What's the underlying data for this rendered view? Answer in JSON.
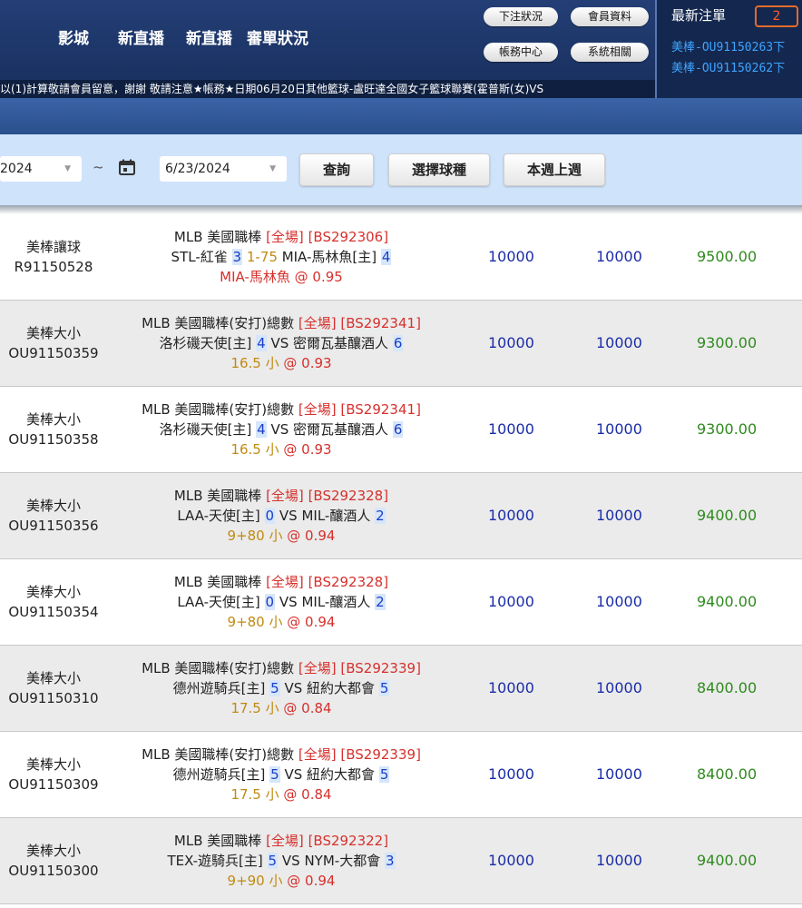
{
  "header": {
    "nav": [
      "影城",
      "新直播",
      "新直播",
      "審單狀況"
    ],
    "buttons": {
      "bet_status": "下注狀況",
      "member_info": "會員資料",
      "accounts": "帳務中心",
      "system": "系統相關"
    },
    "latest": {
      "title": "最新注單",
      "count": "2",
      "lines": [
        "美棒-OU91150263下",
        "美棒-OU91150262下"
      ]
    }
  },
  "ticker": "以(1)計算敬請會員留意，謝謝 敬請注意★帳務★日期06月20日其他籃球-盧旺達全國女子籃球聯賽(霍普斯(女)VS",
  "filter": {
    "start_date": "2024",
    "separator": "~",
    "end_date": "6/23/2024",
    "query": "查詢",
    "select_sport": "選擇球種",
    "week": "本週上週"
  },
  "rows": [
    {
      "type": "美棒讓球",
      "id": "R91150528",
      "league": "MLB 美國職棒",
      "market": "[全場]",
      "code": "[BS292306]",
      "home": "STL-紅雀",
      "home_score": "3",
      "handicap": "1-75",
      "away": "MIA-馬林魚[主]",
      "away_score": "4",
      "pick": "MIA-馬林魚",
      "pick_style": "red",
      "odds": "@ 0.95",
      "bet": "10000",
      "valid": "10000",
      "win": "9500.00"
    },
    {
      "type": "美棒大小",
      "id": "OU91150359",
      "league": "MLB 美國職棒(安打)總數",
      "market": "[全場]",
      "code": "[BS292341]",
      "home": "洛杉磯天使[主]",
      "home_score": "4",
      "handicap": "VS",
      "away": "密爾瓦基釀酒人",
      "away_score": "6",
      "pick": "16.5 小",
      "pick_style": "gold",
      "odds": "@ 0.93",
      "bet": "10000",
      "valid": "10000",
      "win": "9300.00"
    },
    {
      "type": "美棒大小",
      "id": "OU91150358",
      "league": "MLB 美國職棒(安打)總數",
      "market": "[全場]",
      "code": "[BS292341]",
      "home": "洛杉磯天使[主]",
      "home_score": "4",
      "handicap": "VS",
      "away": "密爾瓦基釀酒人",
      "away_score": "6",
      "pick": "16.5 小",
      "pick_style": "gold",
      "odds": "@ 0.93",
      "bet": "10000",
      "valid": "10000",
      "win": "9300.00"
    },
    {
      "type": "美棒大小",
      "id": "OU91150356",
      "league": "MLB 美國職棒",
      "market": "[全場]",
      "code": "[BS292328]",
      "home": "LAA-天使[主]",
      "home_score": "0",
      "handicap": "VS",
      "away": "MIL-釀酒人",
      "away_score": "2",
      "pick": "9+80 小",
      "pick_style": "gold",
      "odds": "@ 0.94",
      "bet": "10000",
      "valid": "10000",
      "win": "9400.00"
    },
    {
      "type": "美棒大小",
      "id": "OU91150354",
      "league": "MLB 美國職棒",
      "market": "[全場]",
      "code": "[BS292328]",
      "home": "LAA-天使[主]",
      "home_score": "0",
      "handicap": "VS",
      "away": "MIL-釀酒人",
      "away_score": "2",
      "pick": "9+80 小",
      "pick_style": "gold",
      "odds": "@ 0.94",
      "bet": "10000",
      "valid": "10000",
      "win": "9400.00"
    },
    {
      "type": "美棒大小",
      "id": "OU91150310",
      "league": "MLB 美國職棒(安打)總數",
      "market": "[全場]",
      "code": "[BS292339]",
      "home": "德州遊騎兵[主]",
      "home_score": "5",
      "handicap": "VS",
      "away": "紐約大都會",
      "away_score": "5",
      "pick": "17.5 小",
      "pick_style": "gold",
      "odds": "@ 0.84",
      "bet": "10000",
      "valid": "10000",
      "win": "8400.00"
    },
    {
      "type": "美棒大小",
      "id": "OU91150309",
      "league": "MLB 美國職棒(安打)總數",
      "market": "[全場]",
      "code": "[BS292339]",
      "home": "德州遊騎兵[主]",
      "home_score": "5",
      "handicap": "VS",
      "away": "紐約大都會",
      "away_score": "5",
      "pick": "17.5 小",
      "pick_style": "gold",
      "odds": "@ 0.84",
      "bet": "10000",
      "valid": "10000",
      "win": "8400.00"
    },
    {
      "type": "美棒大小",
      "id": "OU91150300",
      "league": "MLB 美國職棒",
      "market": "[全場]",
      "code": "[BS292322]",
      "home": "TEX-遊騎兵[主]",
      "home_score": "5",
      "handicap": "VS",
      "away": "NYM-大都會",
      "away_score": "3",
      "pick": "9+90 小",
      "pick_style": "gold",
      "odds": "@ 0.94",
      "bet": "10000",
      "valid": "10000",
      "win": "9400.00"
    }
  ],
  "colors": {
    "header": "#1f3a70",
    "filter_bg": "#cfe3fb",
    "amount": "#1a2ca8",
    "win": "#2f8a1e",
    "accent_red": "#d6302c",
    "pick_gold": "#c08a12"
  }
}
